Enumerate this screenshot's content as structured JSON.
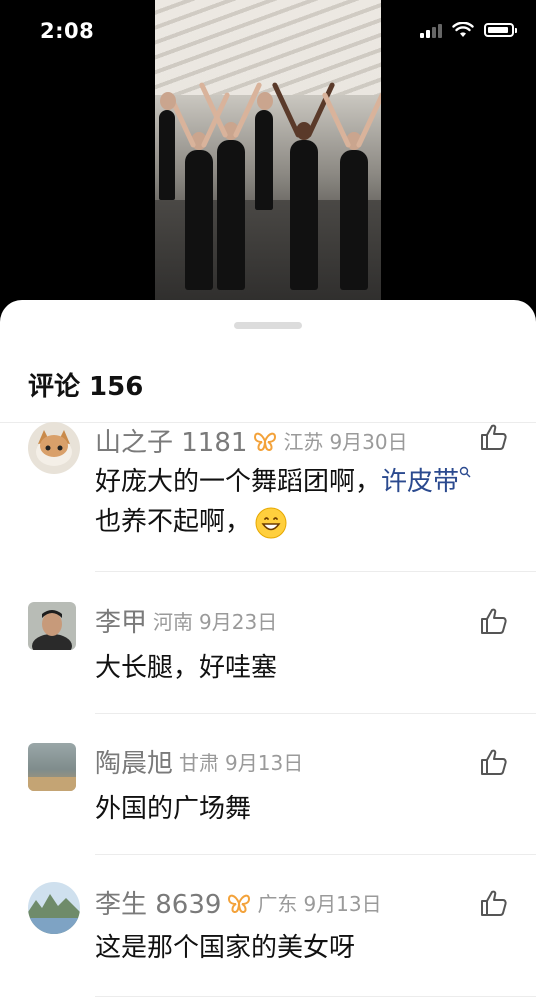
{
  "status": {
    "time": "2:08"
  },
  "sheet": {
    "title": "评论 156"
  },
  "comments": [
    {
      "username": "山之子 1181",
      "has_badge": true,
      "region": "江苏",
      "date": "9月30日",
      "text_before": "好庞大的一个舞蹈团啊，",
      "link": "许皮带",
      "text_after": "也养不起啊，",
      "emoji": "grinning-face"
    },
    {
      "username": "李甲",
      "has_badge": false,
      "region": "河南",
      "date": "9月23日",
      "text": "大长腿，好哇塞"
    },
    {
      "username": "陶晨旭",
      "has_badge": false,
      "region": "甘肃",
      "date": "9月13日",
      "text": "外国的广场舞"
    },
    {
      "username": "李生 8639",
      "has_badge": true,
      "region": "广东",
      "date": "9月13日",
      "text": "这是那个国家的美女呀"
    }
  ],
  "icons": {
    "like": "thumbs-up-icon",
    "badge": "butterfly-badge-icon",
    "search": "search-icon"
  },
  "colors": {
    "link": "#2b4a8f",
    "badge": "#f3a23a",
    "meta": "#9a9a9a"
  }
}
